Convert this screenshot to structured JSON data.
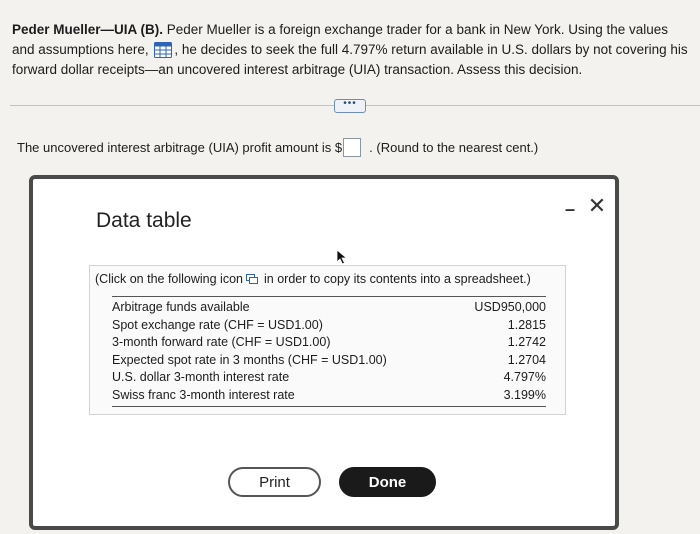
{
  "question": {
    "title": "Peder Mueller—UIA (B).",
    "text_part1": " Peder Mueller is a foreign exchange trader for a bank in New York. Using the values and assumptions here, ",
    "text_part2": ", he decides to seek the full 4.797% return available in U.S. dollars by not covering his forward dollar receipts—an uncovered interest arbitrage (UIA) transaction. Assess this decision."
  },
  "more_button": {
    "label": "•••"
  },
  "answer": {
    "prefix": "The uncovered interest arbitrage (UIA) profit amount is $",
    "value": "",
    "suffix": ". (Round to the nearest cent.)"
  },
  "modal": {
    "title": "Data table",
    "minimize_label": "–",
    "close_label": "✕",
    "copy_instruction_part1": "(Click on the following icon",
    "copy_instruction_part2": "in order to copy its contents into a spreadsheet.)",
    "rows": [
      {
        "label": "Arbitrage funds available",
        "value": "USD950,000"
      },
      {
        "label": "Spot exchange rate (CHF = USD1.00)",
        "value": "1.2815"
      },
      {
        "label": "3-month forward rate (CHF = USD1.00)",
        "value": "1.2742"
      },
      {
        "label": "Expected spot rate in 3 months (CHF = USD1.00)",
        "value": "1.2704"
      },
      {
        "label": "U.S. dollar 3-month interest rate",
        "value": "4.797%"
      },
      {
        "label": "Swiss franc 3-month interest rate",
        "value": "3.199%"
      }
    ],
    "print_label": "Print",
    "done_label": "Done"
  },
  "colors": {
    "page_background": "#f3f2ee",
    "icon_blue": "#2f63b8",
    "done_button": "#1a1a1a"
  },
  "icons": {
    "data_table_icon": "spreadsheet-grid",
    "copy_icon": "copy-to-spreadsheet",
    "cursor": "mouse-pointer"
  }
}
